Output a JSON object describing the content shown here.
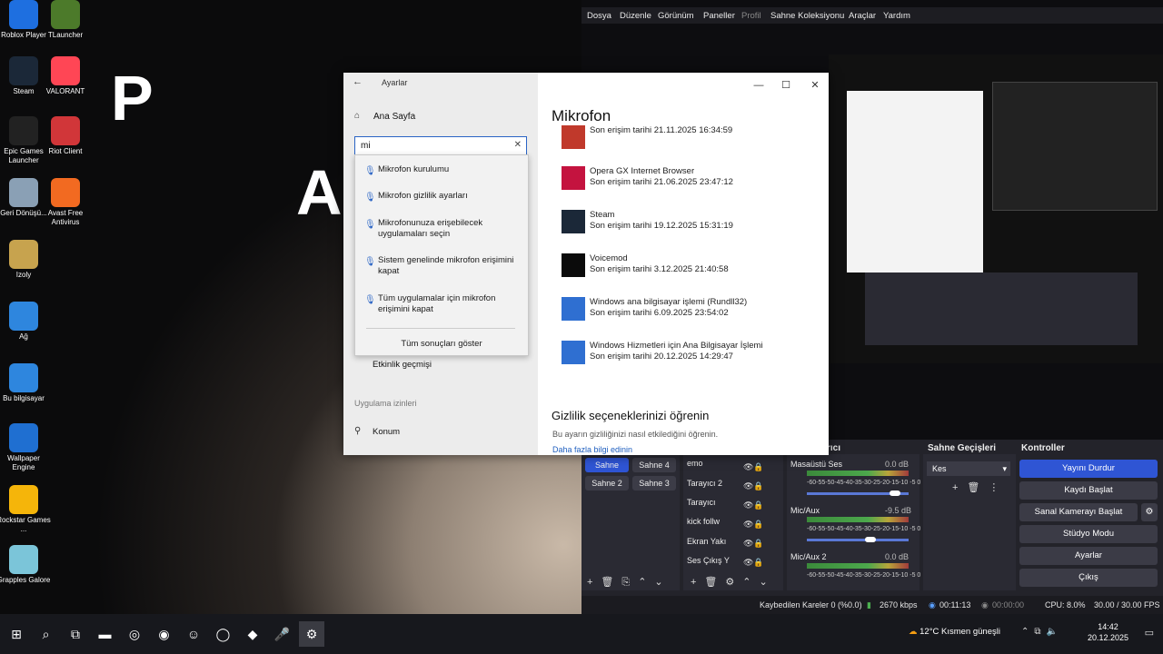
{
  "desktop": {
    "icons": [
      {
        "label": "Roblox Player",
        "icon": "roblox-icon",
        "color": "#1e6fe0"
      },
      {
        "label": "TLauncher",
        "icon": "minecraft-icon",
        "color": "#4c7a2a"
      },
      {
        "label": "Steam",
        "icon": "steam-icon",
        "color": "#1b2838"
      },
      {
        "label": "VALORANT",
        "icon": "valorant-icon",
        "color": "#ff4655"
      },
      {
        "label": "Epic Games Launcher",
        "icon": "epic-icon",
        "color": "#222222"
      },
      {
        "label": "Riot Client",
        "icon": "riot-icon",
        "color": "#d13639"
      },
      {
        "label": "Geri Dönüşü...",
        "icon": "recycle-bin-icon",
        "color": "#8aa0b5"
      },
      {
        "label": "Avast Free Antivirus",
        "icon": "avast-icon",
        "color": "#f26a21"
      },
      {
        "label": "Izoly",
        "icon": "izoly-icon",
        "color": "#c7a34e"
      },
      {
        "label": "Ağ",
        "icon": "network-icon",
        "color": "#2e86de"
      },
      {
        "label": "Bu bilgisayar",
        "icon": "pc-icon",
        "color": "#2e86de"
      },
      {
        "label": "Wallpaper Engine",
        "icon": "wallpaper-engine-icon",
        "color": "#1f6fd1"
      },
      {
        "label": "Rockstar Games ...",
        "icon": "rockstar-icon",
        "color": "#f5b50a"
      },
      {
        "label": "Grapples Galore",
        "icon": "grapples-icon",
        "color": "#7bc5d9"
      }
    ],
    "big_letters": [
      "P",
      "A"
    ]
  },
  "settings": {
    "title": "Ayarlar",
    "home": "Ana Sayfa",
    "search_value": "mi",
    "suggestions": [
      "Mikrofon kurulumu",
      "Mikrofon gizlilik ayarları",
      "Mikrofonunuza erişebilecek uygulamaları seçin",
      "Sistem genelinde mikrofon erişimini kapat",
      "Tüm uygulamalar için mikrofon erişimini kapat"
    ],
    "show_all": "Tüm sonuçları göster",
    "nav_activity": "Etkinlik geçmişi",
    "section_app_perms": "Uygulama izinleri",
    "nav_location": "Konum",
    "page_title": "Mikrofon",
    "apps": [
      {
        "name": "",
        "date": "Son erişim tarihi 21.11.2025 16:34:59",
        "icon": "roblox-icon",
        "color": "#c0392b"
      },
      {
        "name": "Opera GX Internet Browser",
        "date": "Son erişim tarihi 21.06.2025 23:47:12",
        "icon": "opera-gx-icon",
        "color": "#c4133f"
      },
      {
        "name": "Steam",
        "date": "Son erişim tarihi 19.12.2025 15:31:19",
        "icon": "steam-icon",
        "color": "#1b2838"
      },
      {
        "name": "Voicemod",
        "date": "Son erişim tarihi 3.12.2025 21:40:58",
        "icon": "voicemod-icon",
        "color": "#0b0b0b"
      },
      {
        "name": "Windows ana bilgisayar işlemi (Rundll32)",
        "date": "Son erişim tarihi 6.09.2025 23:54:02",
        "icon": "file-icon",
        "color": "#2f6fd1"
      },
      {
        "name": "Windows Hizmetleri için Ana Bilgisayar İşlemi",
        "date": "Son erişim tarihi 20.12.2025 14:29:47",
        "icon": "file-icon",
        "color": "#2f6fd1"
      }
    ],
    "privacy_heading": "Gizlilik seçeneklerinizi öğrenin",
    "privacy_text": "Bu ayarın gizliliğinizi nasıl etkilediğini öğrenin.",
    "privacy_link": "Daha fazla bilgi edinin"
  },
  "obs": {
    "menu": [
      "Dosya",
      "Düzenle",
      "Görünüm",
      "Paneller",
      "Profil",
      "Sahne Koleksiyonu",
      "Araçlar",
      "Yardım"
    ],
    "dock_titles": {
      "mixer": "rıcı",
      "transitions": "Sahne Geçişleri",
      "controls": "Kontroller"
    },
    "scenes": [
      "Sahne",
      "Sahne 4",
      "Sahne 2",
      "Sahne 3"
    ],
    "sources": [
      "emo",
      "Tarayıcı 2",
      "Tarayıcı",
      "kick follw",
      "Ekran Yakı",
      "Ses Çıkış Y"
    ],
    "mixer": [
      {
        "name": "Masaüstü Ses",
        "db": "0.0 dB",
        "level": 0.91
      },
      {
        "name": "Mic/Aux",
        "db": "-9.5 dB",
        "level": 0.64
      },
      {
        "name": "Mic/Aux 2",
        "db": "0.0 dB",
        "level": 0.91
      }
    ],
    "meter_ticks": "-60-55-50-45-40-35-30-25-20-15-10 -5 0",
    "transition": "Kes",
    "controls": [
      "Yayını Durdur",
      "Kaydı Başlat",
      "Sanal Kamerayı Başlat",
      "Stüdyo Modu",
      "Ayarlar",
      "Çıkış"
    ],
    "status": {
      "dropped": "Kaybedilen Kareler 0 (%0.0)",
      "bitrate": "2670 kbps",
      "live_time": "00:11:13",
      "rec_time": "00:00:00",
      "cpu": "CPU: 8.0%",
      "fps": "30.00 / 30.00 FPS"
    },
    "colors": {
      "accent": "#2f55d4",
      "panel": "#2a2a33"
    }
  },
  "taskbar": {
    "weather": "12°C  Kısmen güneşli",
    "time": "14:42",
    "date": "20.12.2025",
    "icons": [
      "windows-start-icon",
      "search-icon",
      "task-view-icon",
      "file-explorer-icon",
      "chrome-icon",
      "steam-icon",
      "discord-icon",
      "opera-gx-icon",
      "roblox-icon",
      "microphone-icon",
      "settings-icon"
    ]
  }
}
